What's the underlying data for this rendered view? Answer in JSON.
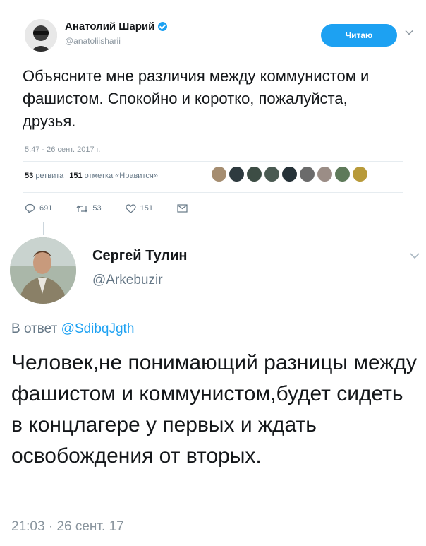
{
  "tweet1": {
    "author_name": "Анатолий Шарий",
    "author_handle": "@anatoliisharii",
    "follow_label": "Читаю",
    "text": "Объясните мне различия между коммунистом и фашистом. Спокойно и коротко, пожалуйста, друзья.",
    "timestamp": "5:47 - 26 сент. 2017 г.",
    "retweets_count": "53",
    "retweets_label": "ретвита",
    "likes_count": "151",
    "likes_label": "отметка «Нравится»",
    "reply_count": "691",
    "retweet_count_small": "53",
    "like_count_small": "151"
  },
  "tweet2": {
    "author_name": "Сергей Тулин",
    "author_handle": "@Arkebuzir",
    "reply_prefix": "В ответ",
    "reply_handle": "@SdibqJgth",
    "text": "Человек,не понимающий разницы между фашистом и коммунистом,будет сидеть в концлагере у первых и ждать освобождения от вторых.",
    "timestamp": "21:03 · 26 сент. 17"
  },
  "colors": {
    "accent": "#1da1f2",
    "text": "#14171a",
    "secondary": "#657786"
  }
}
